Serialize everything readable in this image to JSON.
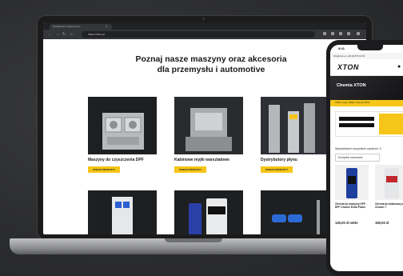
{
  "browser": {
    "tab_title": "Urządzenia i maszyny do...",
    "url": "https://xton.pl"
  },
  "page": {
    "heading_line1": "Poznaj nasze maszyny oraz akcesoria",
    "heading_line2": "dla przemysłu i automotive",
    "button_label": "ZOBACZ PRODUKTY",
    "cards": [
      {
        "title": "Maszyny do czyszczenia DPF"
      },
      {
        "title": "Kabinowe myjki warsztatowe"
      },
      {
        "title": "Dystrybutory płynu"
      },
      {
        "title": ""
      },
      {
        "title": ""
      },
      {
        "title": ""
      }
    ]
  },
  "phone": {
    "time": "9:41",
    "contact": "info@xton.eu   +48 46 870 10 00",
    "logo": "XTON",
    "hero_title": "Chemia XTON",
    "yellow_bar": "XTON 2 razy o Bliżej • Chemia XTON",
    "filter_label": "Wyświetlanie wszystkich wyników: 5",
    "sort_label": "Domyślne sortowanie",
    "products": [
      {
        "name": "Chemia do maszyny DPF - DPF Cleaner Extra Power",
        "price": "130,00 zł netto"
      },
      {
        "name": "Chemia do kabinowej myjki Cleaner 7",
        "price": "150,00 zł"
      }
    ]
  },
  "colors": {
    "accent": "#f5c518",
    "background": "#2b2c2e"
  }
}
